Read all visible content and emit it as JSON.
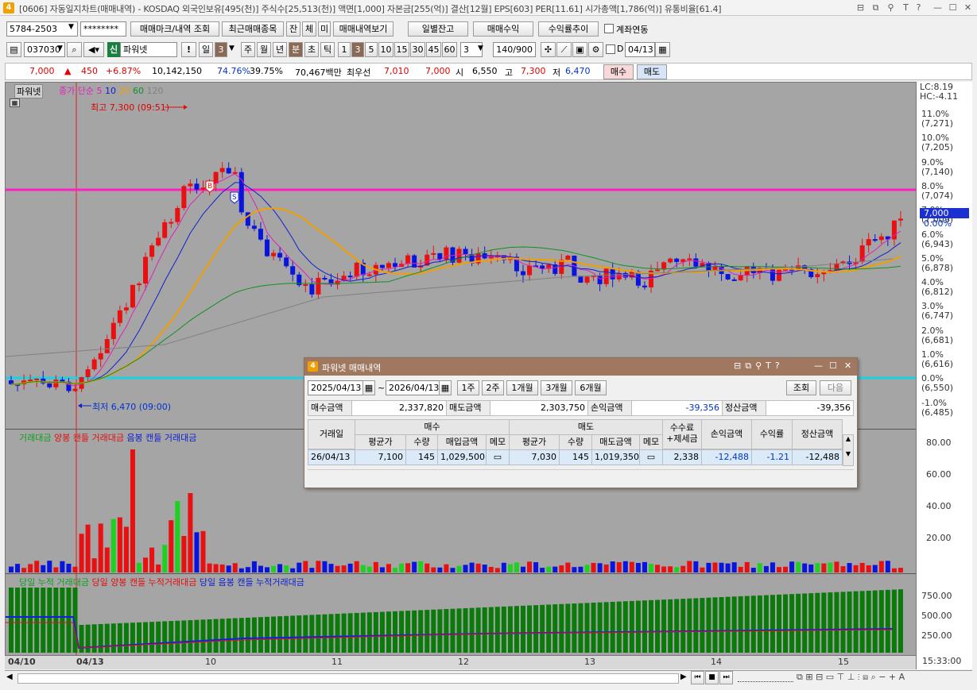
{
  "titlebar": {
    "title": "[0606] 자동일지차트(매매내역) - KOSDAQ 외국인보유[495(천)] 주식수[25,513(천)] 액면[1,000] 자본금[255(억)] 결산[12월] EPS[603] PER[11.61] 시가총액[1,786(억)] 유통비율[61.4]",
    "app_number": "4"
  },
  "toolbar1": {
    "account": "5784-2503",
    "password": "********",
    "btn_mark": "매매마크/내역 조회",
    "btn_recent": "최근매매종목",
    "btn_jan": "잔",
    "btn_che": "체",
    "btn_mi": "미",
    "btn_history": "매매내역보기",
    "btn_daily_balance": "일별잔고",
    "btn_trade_profit": "매매수익",
    "btn_return_trend": "수익률추이",
    "chk_linked": "계좌연동"
  },
  "toolbar2": {
    "code": "037030",
    "badge": "신",
    "stock_name": "파워넷",
    "warn": "!",
    "period_day": "일",
    "period_num": "3",
    "btn_week": "주",
    "btn_month": "월",
    "btn_year": "년",
    "btn_minute": "분",
    "btn_second": "초",
    "btn_tick": "틱",
    "intervals": [
      "1",
      "3",
      "5",
      "10",
      "15",
      "30",
      "45",
      "60"
    ],
    "interval_selected": "3",
    "interval_value": "3",
    "count": "140/900",
    "date": "04/13"
  },
  "quote": {
    "price": "7,000",
    "change": "450",
    "change_pct": "+6.87%",
    "volume": "10,142,150",
    "rate1": "74.76%",
    "rate2": "39.75%",
    "amount": "70,467백만",
    "best_label": "최우선",
    "best_ask": "7,010",
    "best_bid": "7,000",
    "open_label": "시",
    "open": "6,550",
    "high_label": "고",
    "high": "7,300",
    "low_label": "저",
    "low": "6,470",
    "btn_buy": "매수",
    "btn_sell": "매도"
  },
  "chart": {
    "stock_tag": "파워넷",
    "legend": [
      "종가",
      "단순",
      "5",
      "10",
      "20",
      "60",
      "120"
    ],
    "high_label": "최고 7,300 (09:51)",
    "low_label": "최저 6,470 (09:00)",
    "lc": "LC:8.19",
    "hc": "HC:-4.11",
    "current_price_tag": "7,000",
    "price_ticks": [
      [
        "11.0%",
        "(7,271)"
      ],
      [
        "10.0%",
        "(7,205)"
      ],
      [
        "9.0%",
        "(7,140)"
      ],
      [
        "8.0%",
        "(7,074)"
      ],
      [
        "7.0%",
        "(7,009)"
      ],
      [
        "6.0%",
        "(6,943)"
      ],
      [
        "5.0%",
        "(6,878)"
      ],
      [
        "4.0%",
        "(6,812)"
      ],
      [
        "3.0%",
        "(6,747)"
      ],
      [
        "2.0%",
        "(6,681)"
      ],
      [
        "1.0%",
        "(6,616)"
      ],
      [
        "0.0%",
        "(6,550)"
      ],
      [
        "-1.0%",
        "(6,485)"
      ]
    ],
    "zero_label": "0.00%",
    "vol_legend": [
      "거래대금",
      "양봉 캔들 거래대금",
      "음봉 캔들 거래대금"
    ],
    "vol_ticks": [
      "80.00",
      "60.00",
      "40.00",
      "20.00"
    ],
    "cum_legend": [
      "당일 누적 거래대금",
      "당일 양봉 캔들 누적거래대금",
      "당일 음봉 캔들 누적거래대금"
    ],
    "cum_ticks": [
      "750.00",
      "500.00",
      "250.00"
    ],
    "x_labels": [
      "04/10",
      "04/13",
      "10",
      "11",
      "12",
      "13",
      "14",
      "15"
    ],
    "time_label": "15:33:00",
    "buy_marker": "B",
    "sell_marker": "S",
    "colors": {
      "up": "#e81010",
      "down": "#0a14e0",
      "bg": "#a5a5a5",
      "ma5": "#e020c0",
      "ma10": "#1020d0",
      "ma20": "#f0a000",
      "ma60": "#109020",
      "ma120": "#808080",
      "hline_pink": "#ff20c0",
      "hline_cyan": "#20d0e0"
    }
  },
  "popup": {
    "title": "파워넷 매매내역",
    "app_number": "4",
    "date_from": "2025/04/13",
    "tilde": "~",
    "date_to": "2026/04/13",
    "periods": [
      "1주",
      "2주",
      "1개월",
      "3개월",
      "6개월"
    ],
    "btn_query": "조회",
    "btn_next": "다음",
    "summary": {
      "buy_label": "매수금액",
      "buy_value": "2,337,820",
      "sell_label": "매도금액",
      "sell_value": "2,303,750",
      "pl_label": "손익금액",
      "pl_value": "-39,356",
      "settle_label": "정산금액",
      "settle_value": "-39,356"
    },
    "table": {
      "col_date": "거래일",
      "grp_buy": "매수",
      "grp_sell": "매도",
      "col_fee": "수수료\n+제세금",
      "col_pl": "손익금액",
      "col_rate": "수익률",
      "col_settle": "정산금액",
      "sub": [
        "평균가",
        "수량",
        "매입금액",
        "메모",
        "평균가",
        "수량",
        "매도금액",
        "메모"
      ],
      "rows": [
        {
          "date": "26/04/13",
          "buy_avg": "7,100",
          "buy_qty": "145",
          "buy_amt": "1,029,500",
          "sell_avg": "7,030",
          "sell_qty": "145",
          "sell_amt": "1,019,350",
          "fee": "2,338",
          "pl": "-12,488",
          "rate": "-1.21",
          "settle": "-12,488"
        }
      ]
    }
  }
}
